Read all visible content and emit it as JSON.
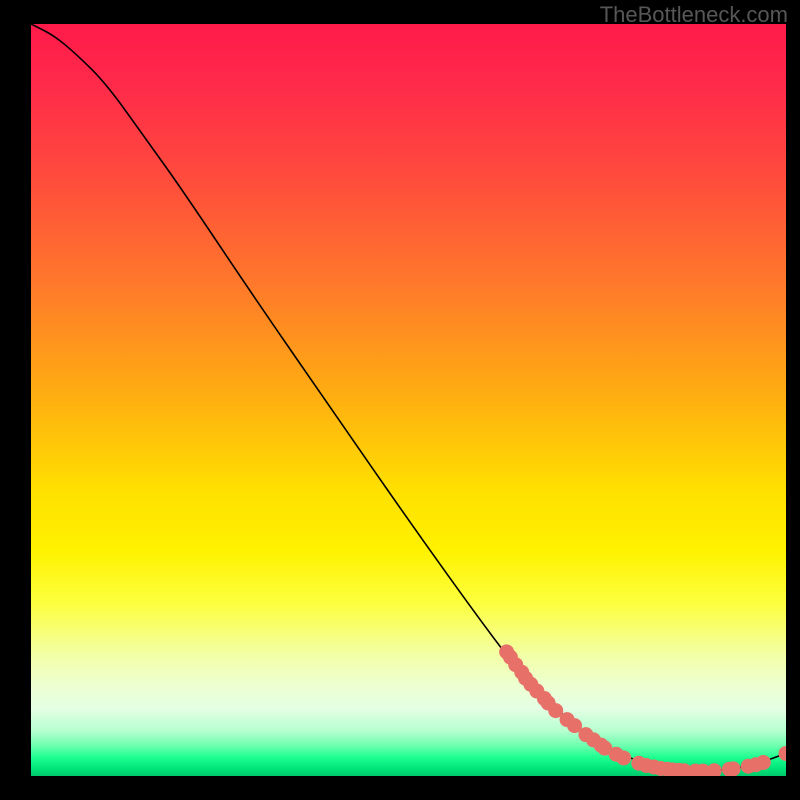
{
  "watermark": "TheBottleneck.com",
  "chart_data": {
    "type": "line",
    "title": "",
    "xlabel": "",
    "ylabel": "",
    "xlim": [
      0,
      100
    ],
    "ylim": [
      0,
      100
    ],
    "curve": [
      {
        "x": 0,
        "y": 100
      },
      {
        "x": 3,
        "y": 98.5
      },
      {
        "x": 6,
        "y": 96
      },
      {
        "x": 10,
        "y": 92
      },
      {
        "x": 15,
        "y": 85
      },
      {
        "x": 20,
        "y": 78
      },
      {
        "x": 30,
        "y": 63
      },
      {
        "x": 40,
        "y": 48.5
      },
      {
        "x": 50,
        "y": 34
      },
      {
        "x": 60,
        "y": 20
      },
      {
        "x": 65,
        "y": 13.5
      },
      {
        "x": 70,
        "y": 8.5
      },
      {
        "x": 75,
        "y": 4.5
      },
      {
        "x": 80,
        "y": 2
      },
      {
        "x": 85,
        "y": 0.8
      },
      {
        "x": 90,
        "y": 0.6
      },
      {
        "x": 95,
        "y": 1.2
      },
      {
        "x": 100,
        "y": 3
      }
    ],
    "marker_points": [
      {
        "x": 63,
        "y": 16.5
      },
      {
        "x": 63.5,
        "y": 15.8
      },
      {
        "x": 64.2,
        "y": 14.8
      },
      {
        "x": 65,
        "y": 13.8
      },
      {
        "x": 65.5,
        "y": 13.0
      },
      {
        "x": 66.2,
        "y": 12.2
      },
      {
        "x": 67,
        "y": 11.3
      },
      {
        "x": 68,
        "y": 10.3
      },
      {
        "x": 68.5,
        "y": 9.7
      },
      {
        "x": 69.5,
        "y": 8.7
      },
      {
        "x": 71,
        "y": 7.5
      },
      {
        "x": 72,
        "y": 6.7
      },
      {
        "x": 73.5,
        "y": 5.5
      },
      {
        "x": 74.5,
        "y": 4.8
      },
      {
        "x": 75.5,
        "y": 4.1
      },
      {
        "x": 76,
        "y": 3.7
      },
      {
        "x": 77.5,
        "y": 2.9
      },
      {
        "x": 78.5,
        "y": 2.4
      },
      {
        "x": 80.5,
        "y": 1.7
      },
      {
        "x": 81.5,
        "y": 1.4
      },
      {
        "x": 82.5,
        "y": 1.2
      },
      {
        "x": 83.4,
        "y": 1.0
      },
      {
        "x": 84.3,
        "y": 0.9
      },
      {
        "x": 85,
        "y": 0.8
      },
      {
        "x": 85.8,
        "y": 0.75
      },
      {
        "x": 86.5,
        "y": 0.7
      },
      {
        "x": 88,
        "y": 0.65
      },
      {
        "x": 89,
        "y": 0.65
      },
      {
        "x": 90.5,
        "y": 0.7
      },
      {
        "x": 92.5,
        "y": 0.9
      },
      {
        "x": 93,
        "y": 0.95
      },
      {
        "x": 95,
        "y": 1.3
      },
      {
        "x": 96,
        "y": 1.5
      },
      {
        "x": 97,
        "y": 1.8
      },
      {
        "x": 100,
        "y": 3
      }
    ],
    "colors": {
      "curve": "#000000",
      "marker_fill": "#e77168",
      "marker_stroke": "#c74c42"
    }
  }
}
